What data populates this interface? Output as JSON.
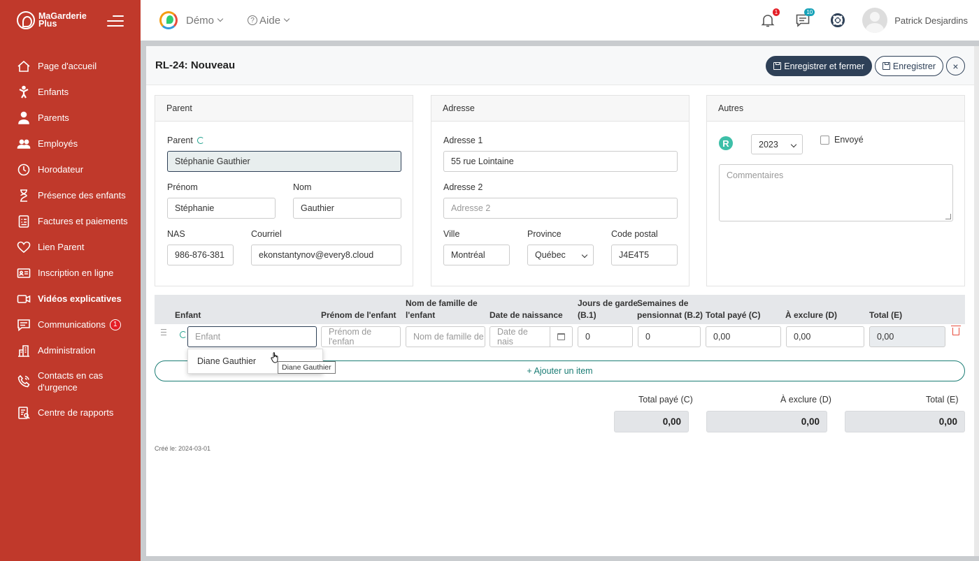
{
  "brand": {
    "line1": "MaGarderie",
    "line2": "Plus"
  },
  "sidebar": {
    "items": [
      {
        "label": "Page d'accueil",
        "icon": "home-icon"
      },
      {
        "label": "Enfants",
        "icon": "child-icon"
      },
      {
        "label": "Parents",
        "icon": "parent-icon"
      },
      {
        "label": "Employés",
        "icon": "employees-icon"
      },
      {
        "label": "Horodateur",
        "icon": "clock-icon"
      },
      {
        "label": "Présence des enfants",
        "icon": "hourglass-icon"
      },
      {
        "label": "Factures et paiements",
        "icon": "invoice-icon"
      },
      {
        "label": "Lien Parent",
        "icon": "heart-icon"
      },
      {
        "label": "Inscription en ligne",
        "icon": "id-card-icon"
      },
      {
        "label": "Vidéos explicatives",
        "icon": "video-icon"
      },
      {
        "label": "Communications",
        "icon": "chat-icon",
        "badge": "1"
      },
      {
        "label": "Administration",
        "icon": "building-icon"
      },
      {
        "label": "Contacts en cas d'urgence",
        "icon": "phone-icon"
      },
      {
        "label": "Centre de rapports",
        "icon": "report-icon"
      }
    ]
  },
  "topbar": {
    "org_label": "Démo",
    "help_label": "Aide",
    "notifications_badge": "1",
    "messages_badge": "10",
    "username": "Patrick Desjardins"
  },
  "header": {
    "title": "RL-24: Nouveau",
    "save_close_label": "Enregistrer et fermer",
    "save_label": "Enregistrer",
    "close_label": "×"
  },
  "parent_panel": {
    "title": "Parent",
    "parent_label": "Parent",
    "parent_value": "Stéphanie Gauthier",
    "prenom_label": "Prénom",
    "prenom_value": "Stéphanie",
    "nom_label": "Nom",
    "nom_value": "Gauthier",
    "nas_label": "NAS",
    "nas_value": "986-876-381",
    "courriel_label": "Courriel",
    "courriel_value": "ekonstantynov@every8.cloud"
  },
  "address_panel": {
    "title": "Adresse",
    "adresse1_label": "Adresse 1",
    "adresse1_value": "55 rue Lointaine",
    "adresse2_label": "Adresse 2",
    "adresse2_placeholder": "Adresse 2",
    "ville_label": "Ville",
    "ville_value": "Montréal",
    "province_label": "Province",
    "province_value": "Québec",
    "code_label": "Code postal",
    "code_value": "J4E4T5"
  },
  "other_panel": {
    "title": "Autres",
    "r_logo": "R",
    "year_value": "2023",
    "sent_label": "Envoyé",
    "comments_placeholder": "Commentaires"
  },
  "items_table": {
    "headers": {
      "enfant": "Enfant",
      "prenom": "Prénom de l'enfant",
      "nom_l1": "Nom de famille de",
      "nom_l2": "l'enfant",
      "dob": "Date de naissance",
      "jours_l1": "Jours de garde",
      "jours_l2": "(B.1)",
      "sem_l1": "Semaines de",
      "sem_l2": "pensionnat (B.2)",
      "paye": "Total payé (C)",
      "exclure": "À exclure (D)",
      "total": "Total (E)"
    },
    "row": {
      "enfant_placeholder": "Enfant",
      "prenom_placeholder": "Prénom de l'enfan",
      "nom_placeholder": "Nom de famille de",
      "dob_placeholder": "Date de nais",
      "jours": "0",
      "semaines": "0",
      "paye": "0,00",
      "exclure": "0,00",
      "total": "0,00"
    },
    "dropdown_option": "Diane Gauthier",
    "tooltip": "Diane Gauthier",
    "add_item_label": "+ Ajouter un item"
  },
  "totals": {
    "paye_label": "Total payé (C)",
    "paye_value": "0,00",
    "exclure_label": "À exclure (D)",
    "exclure_value": "0,00",
    "total_label": "Total (E)",
    "total_value": "0,00"
  },
  "footer": {
    "created": "Créé le: 2024-03-01"
  }
}
